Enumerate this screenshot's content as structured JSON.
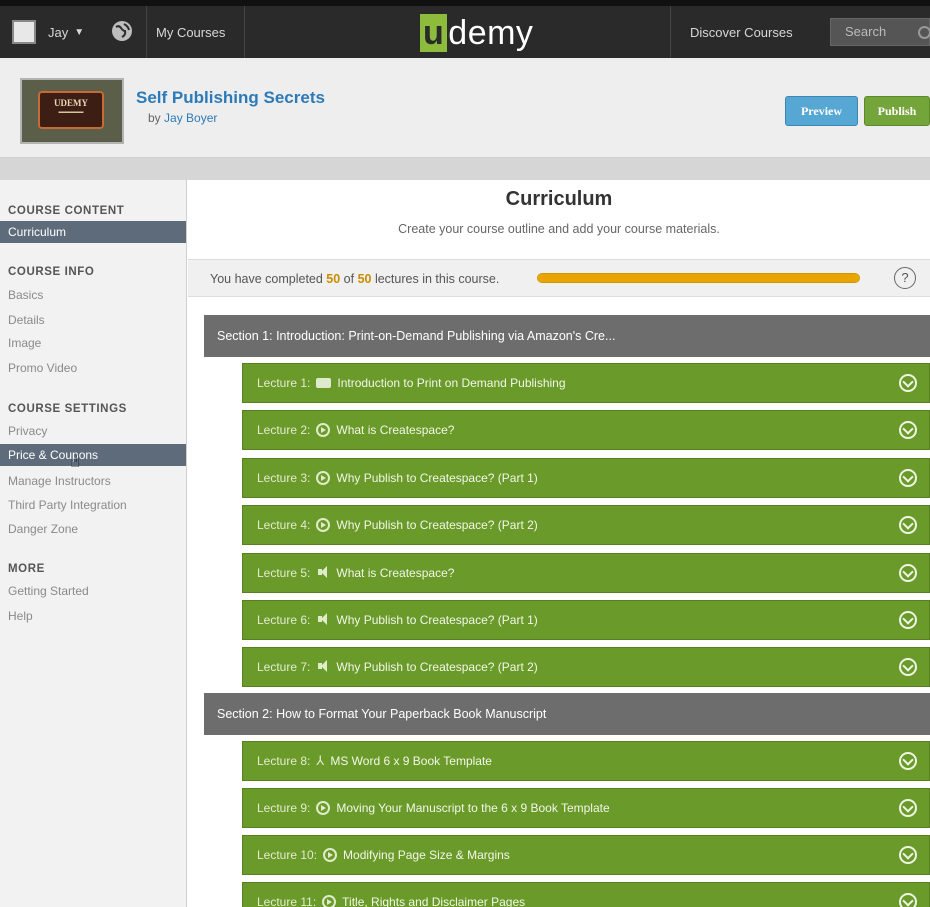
{
  "nav": {
    "user": "Jay",
    "my_courses": "My Courses",
    "logo_u": "u",
    "logo_rest": "demy",
    "discover": "Discover Courses",
    "search_placeholder": "Search"
  },
  "course": {
    "thumb_text": "UDEMY",
    "title": "Self Publishing Secrets",
    "author_prefix": "by ",
    "author": "Jay Boyer",
    "preview_label": "Preview",
    "publish_label": "Publish"
  },
  "sidebar": {
    "content_heading": "COURSE CONTENT",
    "content_items": [
      {
        "label": "Curriculum",
        "active": true
      }
    ],
    "info_heading": "COURSE INFO",
    "info_items": [
      "Basics",
      "Details",
      "Image",
      "Promo Video"
    ],
    "settings_heading": "COURSE SETTINGS",
    "settings_items": [
      "Privacy",
      "Price & Coupons",
      "Manage Instructors",
      "Third Party Integration",
      "Danger Zone"
    ],
    "more_heading": "MORE",
    "more_items": [
      "Getting Started",
      "Help"
    ]
  },
  "main": {
    "title": "Curriculum",
    "subtitle": "Create your course outline and add your course materials.",
    "progress_prefix": "You have completed ",
    "progress_done": "50",
    "progress_mid": " of ",
    "progress_total": "50",
    "progress_suffix": " lectures in this course.",
    "progress_fraction": 1.0,
    "help": "?"
  },
  "curriculum": [
    {
      "kind": "section",
      "text": "Section 1: Introduction: Print-on-Demand Publishing via Amazon's Cre..."
    },
    {
      "kind": "lecture",
      "num": "Lecture 1:",
      "icon": "video-icon",
      "text": "Introduction to Print on Demand Publishing"
    },
    {
      "kind": "lecture",
      "num": "Lecture 2:",
      "icon": "play-icon",
      "text": "What is Createspace?"
    },
    {
      "kind": "lecture",
      "num": "Lecture 3:",
      "icon": "play-icon",
      "text": "Why Publish to Createspace? (Part 1)"
    },
    {
      "kind": "lecture",
      "num": "Lecture 4:",
      "icon": "play-icon",
      "text": "Why Publish to Createspace? (Part 2)"
    },
    {
      "kind": "lecture",
      "num": "Lecture 5:",
      "icon": "audio-icon",
      "text": "What is Createspace?"
    },
    {
      "kind": "lecture",
      "num": "Lecture 6:",
      "icon": "audio-icon",
      "text": "Why Publish to Createspace? (Part 1)"
    },
    {
      "kind": "lecture",
      "num": "Lecture 7:",
      "icon": "audio-icon",
      "text": "Why Publish to Createspace? (Part 2)"
    },
    {
      "kind": "section",
      "text": "Section 2: How to Format Your Paperback Book Manuscript"
    },
    {
      "kind": "lecture",
      "num": "Lecture 8:",
      "icon": "pdf-icon",
      "text": "MS Word 6 x 9 Book Template"
    },
    {
      "kind": "lecture",
      "num": "Lecture 9:",
      "icon": "play-icon",
      "text": "Moving Your Manuscript to the 6 x 9 Book Template"
    },
    {
      "kind": "lecture",
      "num": "Lecture 10:",
      "icon": "play-icon",
      "text": "Modifying Page Size & Margins"
    },
    {
      "kind": "lecture",
      "num": "Lecture 11:",
      "icon": "play-icon",
      "text": "Title, Rights and Disclaimer Pages"
    }
  ],
  "colors": {
    "lecture_green": "#6a9a2a",
    "section_gray": "#6d6d6d",
    "sidebar_active": "#5d6b7b",
    "progress_orange": "#eaa400",
    "link_blue": "#2d7ab8"
  }
}
